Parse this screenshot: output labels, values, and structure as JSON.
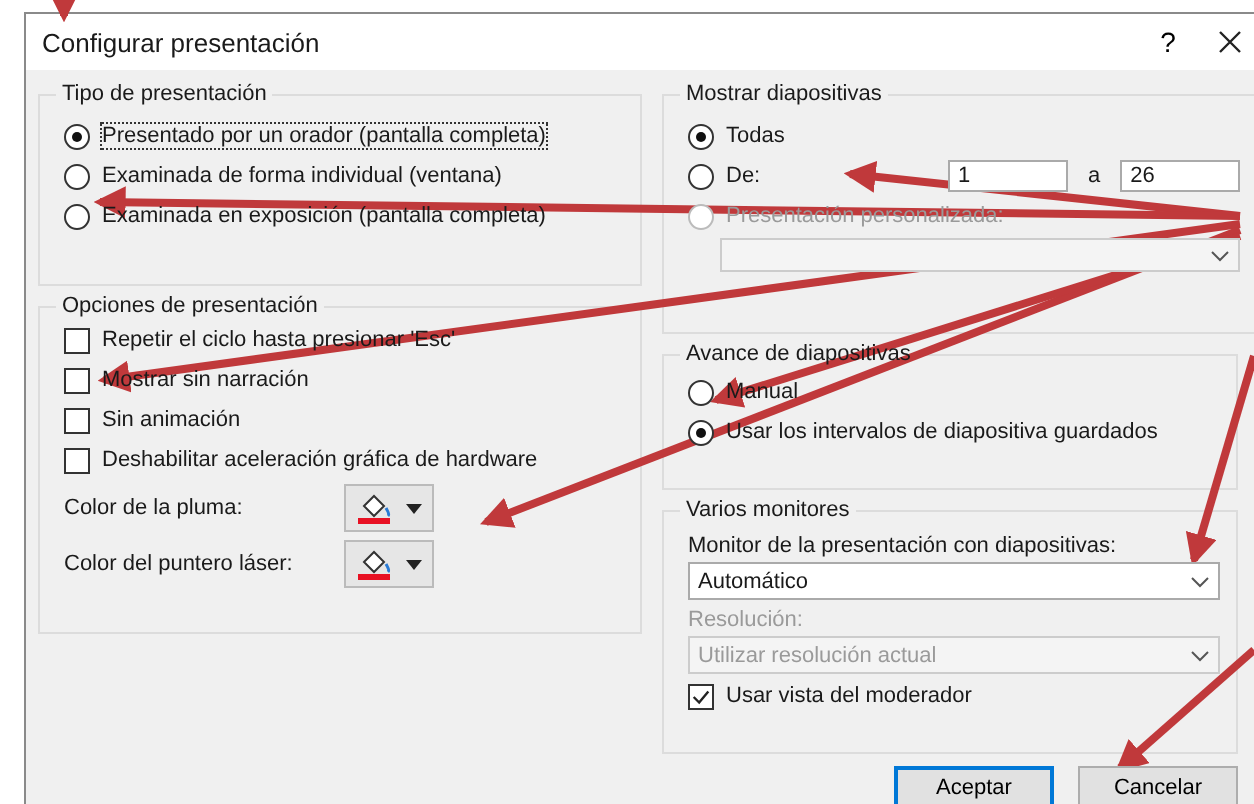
{
  "window": {
    "title": "Configurar presentación",
    "help": "?"
  },
  "presentation_type": {
    "title": "Tipo de presentación",
    "options": [
      {
        "label": "Presentado por un orador (pantalla completa)",
        "selected": true
      },
      {
        "label": "Examinada de forma individual (ventana)",
        "selected": false
      },
      {
        "label": "Examinada en exposición (pantalla completa)",
        "selected": false
      }
    ]
  },
  "presentation_options": {
    "title": "Opciones de presentación",
    "checkboxes": [
      {
        "label": "Repetir el ciclo hasta presionar 'Esc'",
        "checked": false
      },
      {
        "label": "Mostrar sin narración",
        "checked": false
      },
      {
        "label": "Sin animación",
        "checked": false
      },
      {
        "label": "Deshabilitar aceleración gráfica de hardware",
        "checked": false
      }
    ],
    "color_pickers": [
      {
        "label": "Color de la pluma:",
        "color": "#e81123"
      },
      {
        "label": "Color del puntero láser:",
        "color": "#e81123"
      }
    ]
  },
  "show_slides": {
    "title": "Mostrar diapositivas",
    "options": [
      {
        "label": "Todas",
        "selected": true,
        "disabled": false
      },
      {
        "label": "De:",
        "selected": false,
        "disabled": false
      },
      {
        "label": "Presentación personalizada:",
        "selected": false,
        "disabled": true
      }
    ],
    "from": "1",
    "to_label": "a",
    "to": "26"
  },
  "advance": {
    "title": "Avance de diapositivas",
    "options": [
      {
        "label": "Manual",
        "selected": false
      },
      {
        "label": "Usar los intervalos de diapositiva guardados",
        "selected": true
      }
    ]
  },
  "monitors": {
    "title": "Varios monitores",
    "monitor_label": "Monitor de la presentación con diapositivas:",
    "monitor_value": "Automático",
    "resolution_label": "Resolución:",
    "resolution_value": "Utilizar resolución actual",
    "resolution_disabled": true,
    "presenter_view": {
      "label": "Usar vista del moderador",
      "checked": true
    }
  },
  "buttons": [
    {
      "label": "Aceptar",
      "default": true
    },
    {
      "label": "Cancelar",
      "default": false
    }
  ]
}
